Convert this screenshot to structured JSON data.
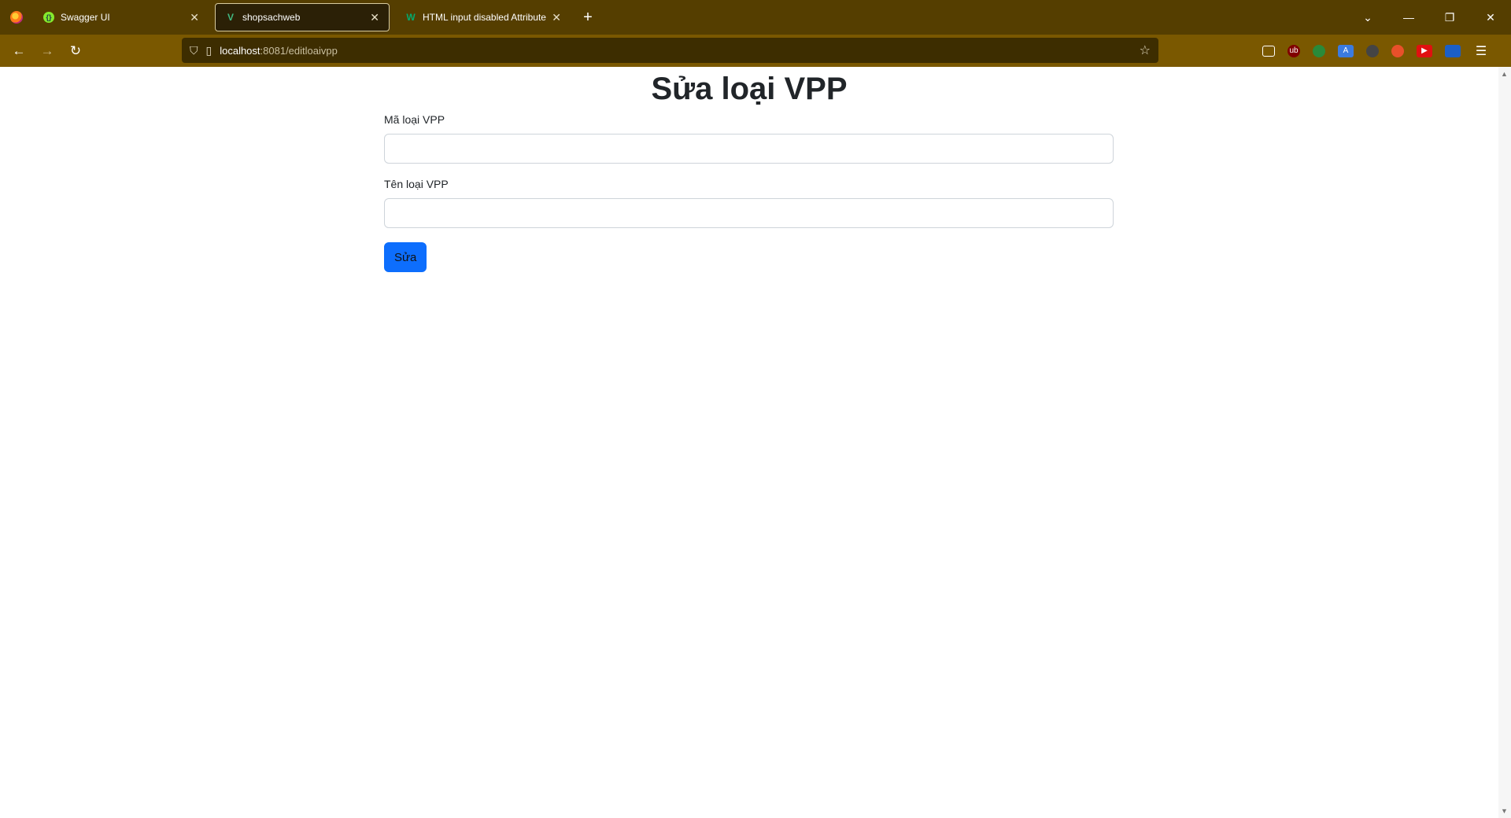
{
  "browser": {
    "tabs": [
      {
        "label": "Swagger UI",
        "icon": "swagger-icon"
      },
      {
        "label": "shopsachweb",
        "icon": "vue-icon",
        "active": true
      },
      {
        "label": "HTML input disabled Attribute",
        "icon": "w3schools-icon"
      }
    ],
    "url_host": "localhost",
    "url_rest": ":8081/editloaivpp"
  },
  "page": {
    "title": "Sửa loại VPP",
    "field1_label": "Mã loại VPP",
    "field1_value": "",
    "field2_label": "Tên loại VPP",
    "field2_value": "",
    "submit_label": "Sửa"
  },
  "colors": {
    "tabbar": "#553e00",
    "navbar": "#7a5800",
    "button": "#0d6efd"
  }
}
